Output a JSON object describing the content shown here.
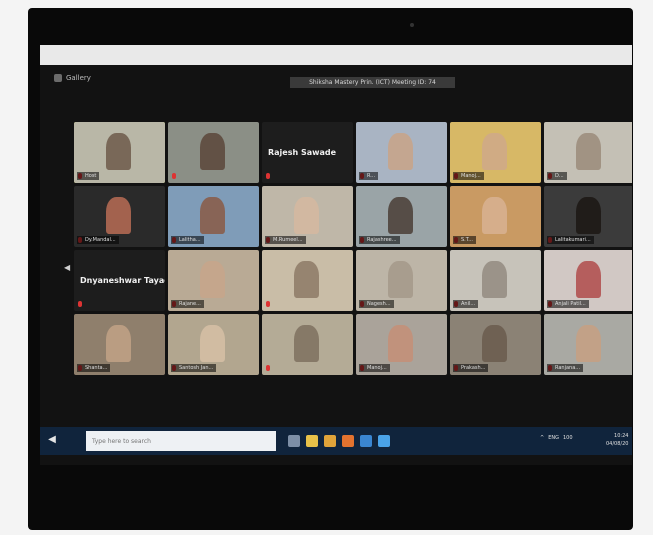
{
  "window": {
    "view_toggle": "Gallery",
    "meeting_title": "Shiksha Mastery Prin. (ICT) Meeting ID: 74"
  },
  "participants": [
    {
      "label": "Host",
      "bg": "#b9b7a7",
      "person": "#6d5a4a",
      "active": true
    },
    {
      "label": "",
      "bg": "#8b8f86",
      "person": "#5a4739"
    },
    {
      "label": "",
      "bg": "#1d1d1d",
      "name_only": "Rajesh Sawade"
    },
    {
      "label": "R...",
      "bg": "#a9b4c3",
      "person": "#c9a387"
    },
    {
      "label": "Manoj...",
      "bg": "#d7b866",
      "person": "#cfa88a"
    },
    {
      "label": "D...",
      "bg": "#c4c0b5",
      "person": "#9b8b7a"
    },
    {
      "label": "Dy.Mandal...",
      "bg": "#2a2a2a",
      "person": "#b86c55"
    },
    {
      "label": "Lalitha...",
      "bg": "#7f9cb8",
      "person": "#8a5b44"
    },
    {
      "label": "M.Rumeel...",
      "bg": "#bfb7a8",
      "person": "#d5b9a0"
    },
    {
      "label": "Rajashree...",
      "bg": "#9aa4a7",
      "person": "#4a3e36"
    },
    {
      "label": "S.T...",
      "bg": "#c99a63",
      "person": "#d8b192"
    },
    {
      "label": "Lalitakumari...",
      "bg": "#3b3b3b",
      "person": "#1c1714"
    },
    {
      "label": "",
      "bg": "#1d1d1d",
      "name_only": "Dnyaneshwar Tayade"
    },
    {
      "label": "Rajane...",
      "bg": "#b9aa95",
      "person": "#c7a68b"
    },
    {
      "label": "",
      "bg": "#c9bda7",
      "person": "#8d7a66"
    },
    {
      "label": "Nagesh...",
      "bg": "#bdb5a7",
      "person": "#a4998a"
    },
    {
      "label": "Anil...",
      "bg": "#c7c3ba",
      "person": "#938b80"
    },
    {
      "label": "Anjali Patil...",
      "bg": "#d1c8c4",
      "person": "#b04b4b"
    },
    {
      "label": "Shanta...",
      "bg": "#8f7f6c",
      "person": "#c2a286"
    },
    {
      "label": "Santosh Jan...",
      "bg": "#b2a68f",
      "person": "#d6c0a6"
    },
    {
      "label": "",
      "bg": "#b4ab96",
      "person": "#7e705f"
    },
    {
      "label": "Manoj...",
      "bg": "#aaa39a",
      "person": "#c58f77"
    },
    {
      "label": "Prakash...",
      "bg": "#8b8275",
      "person": "#6a5c4d"
    },
    {
      "label": "Ranjana...",
      "bg": "#a9a9a3",
      "person": "#c7a083"
    }
  ],
  "taskbar": {
    "search_placeholder": "Type here to search",
    "tray": [
      "^",
      "ENG",
      "100"
    ],
    "time": "10:24",
    "date": "04/08/20",
    "icons": [
      {
        "name": "task-view-icon",
        "color": "#7d8fa6"
      },
      {
        "name": "file-explorer-icon",
        "color": "#e8c249"
      },
      {
        "name": "chrome-icon",
        "color": "#e0a43a"
      },
      {
        "name": "firefox-icon",
        "color": "#e3732f"
      },
      {
        "name": "edge-icon",
        "color": "#3a86d1"
      },
      {
        "name": "zoom-icon",
        "color": "#4aa3e8"
      }
    ]
  }
}
